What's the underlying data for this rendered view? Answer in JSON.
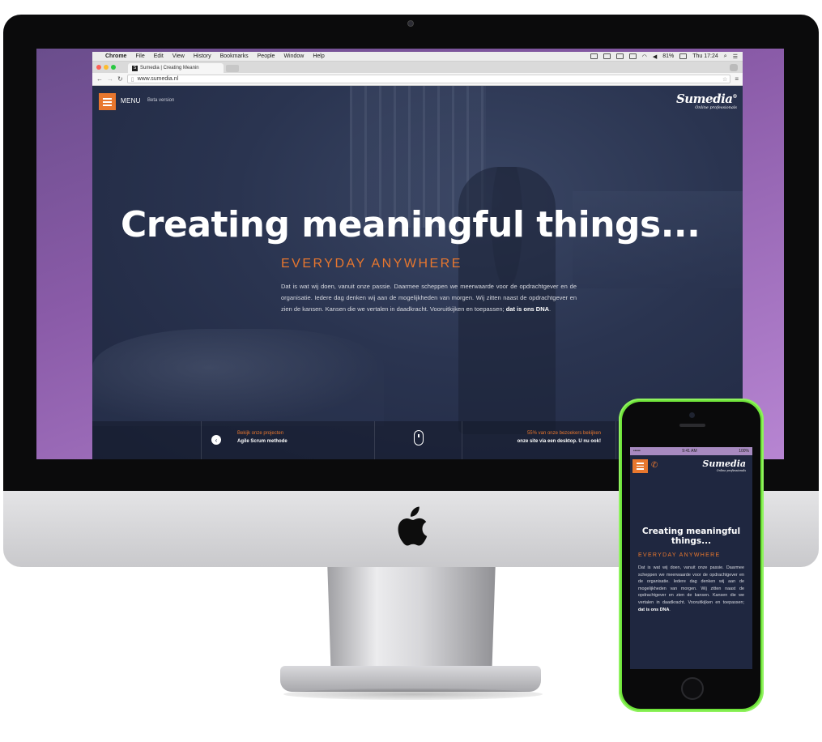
{
  "menubar": {
    "apple": "",
    "items": [
      "Chrome",
      "File",
      "Edit",
      "View",
      "History",
      "Bookmarks",
      "People",
      "Window",
      "Help"
    ],
    "battery": "81%",
    "clock": "Thu 17:24"
  },
  "browser": {
    "tab_title": "Sumedia | Creating Meanin",
    "tab_favicon": "S",
    "url": "www.sumedia.nl"
  },
  "site": {
    "menu_label": "MENU",
    "beta_label": "Beta version",
    "logo_name": "Sumedia",
    "logo_mark": "®",
    "logo_tagline": "Online professionals",
    "hero_title": "Creating meaningful things...",
    "hero_subtitle": "EVERYDAY ANYWHERE",
    "hero_text": "Dat is wat wij doen, vanuit onze passie. Daarmee scheppen we meerwaarde voor de opdrachtgever en de organisatie. Iedere dag denken wij aan de mogelijkheden van morgen. Wij zitten naast de opdrachtgever en zien de kansen. Kansen die we vertalen in daadkracht. Vooruitkijken en toepassen;",
    "hero_text_bold": "dat is ons DNA",
    "hero_text_end": ".",
    "bottom_left_orange": "Bekijk onze projecten",
    "bottom_left_white": "Agile Scrum methode",
    "bottom_right_orange": "55% van onze bezoekers bekijken",
    "bottom_right_white": "onze site via een desktop. U nu ook!",
    "accent_color": "#e8772e"
  },
  "phone": {
    "signal": "•••••",
    "time": "9:41 AM",
    "battery": "100%",
    "title": "Creating meaningful things...",
    "subtitle": "EVERYDAY ANYWHERE",
    "text": "Dat is wat wij doen, vanuit onze passie. Daarmee scheppen we meerwaarde voor de opdrachtgever en de organisatie. Iedere dag denken wij aan de mogelijkheden van morgen. Wij zitten naast de opdrachtgever en zien de kansen. Kansen die we vertalen in daadkracht. Vooruitkijken en toepassen;",
    "text_bold": "dat is ons DNA",
    "text_end": ".",
    "logo_name": "Sumedia",
    "logo_tagline": "Online professionals"
  }
}
